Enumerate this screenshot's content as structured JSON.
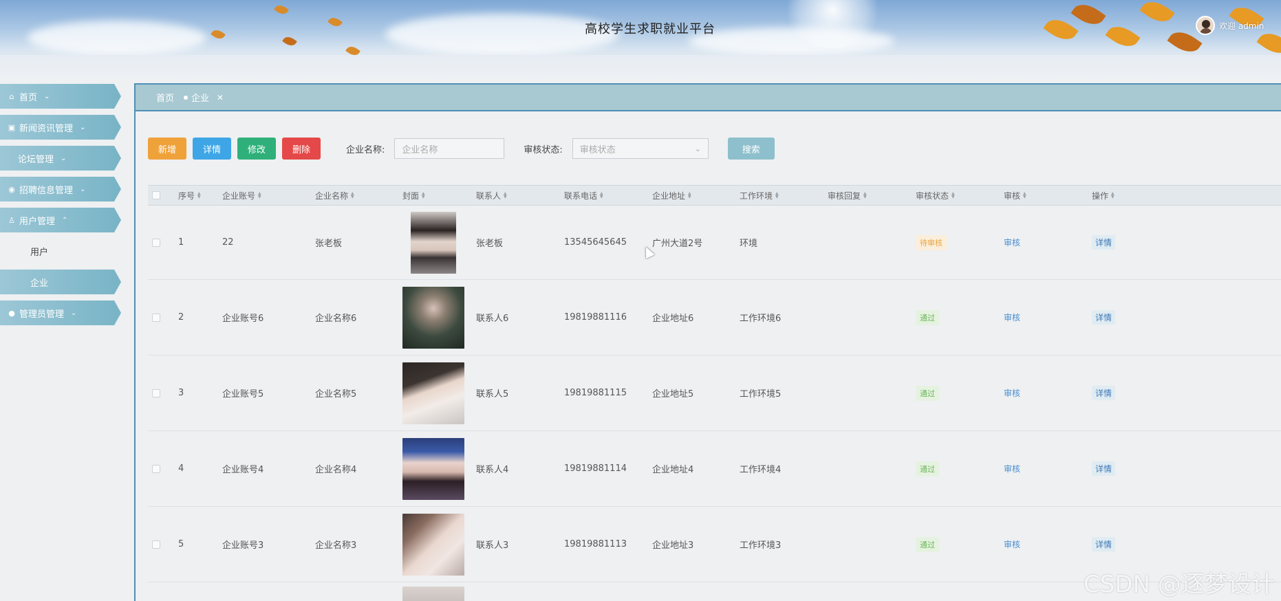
{
  "header": {
    "title": "高校学生求职就业平台",
    "user_text": "欢迎 admin"
  },
  "sidebar": {
    "items": [
      {
        "label": "首页",
        "icon": "home-icon"
      },
      {
        "label": "新闻资讯管理",
        "icon": "news-icon"
      },
      {
        "label": "论坛管理",
        "icon": ""
      },
      {
        "label": "招聘信息管理",
        "icon": "check-circle-icon"
      },
      {
        "label": "用户管理",
        "icon": "user-icon"
      },
      {
        "label": "管理员管理",
        "icon": "admin-icon"
      }
    ],
    "sub_items": [
      {
        "label": "用户"
      },
      {
        "label": "企业"
      }
    ]
  },
  "tabs": [
    {
      "label": "首页"
    },
    {
      "label": "企业"
    }
  ],
  "toolbar": {
    "add_label": "新增",
    "detail_label": "详情",
    "edit_label": "修改",
    "delete_label": "删除",
    "name_label": "企业名称:",
    "name_placeholder": "企业名称",
    "status_label": "审核状态:",
    "status_placeholder": "审核状态",
    "search_label": "搜索"
  },
  "table": {
    "columns": [
      "序号",
      "企业账号",
      "企业名称",
      "封面",
      "联系人",
      "联系电话",
      "企业地址",
      "工作环境",
      "审核回复",
      "审核状态",
      "审核",
      "操作"
    ],
    "rows": [
      {
        "no": "1",
        "account": "22",
        "name": "张老板",
        "contact": "张老板",
        "phone": "13545645645",
        "address": "广州大道2号",
        "env": "环境",
        "reply": "",
        "status": "待审核",
        "status_type": "wait",
        "audit": "审核",
        "op": "详情"
      },
      {
        "no": "2",
        "account": "企业账号6",
        "name": "企业名称6",
        "contact": "联系人6",
        "phone": "19819881116",
        "address": "企业地址6",
        "env": "工作环境6",
        "reply": "",
        "status": "通过",
        "status_type": "pass",
        "audit": "审核",
        "op": "详情"
      },
      {
        "no": "3",
        "account": "企业账号5",
        "name": "企业名称5",
        "contact": "联系人5",
        "phone": "19819881115",
        "address": "企业地址5",
        "env": "工作环境5",
        "reply": "",
        "status": "通过",
        "status_type": "pass",
        "audit": "审核",
        "op": "详情"
      },
      {
        "no": "4",
        "account": "企业账号4",
        "name": "企业名称4",
        "contact": "联系人4",
        "phone": "19819881114",
        "address": "企业地址4",
        "env": "工作环境4",
        "reply": "",
        "status": "通过",
        "status_type": "pass",
        "audit": "审核",
        "op": "详情"
      },
      {
        "no": "5",
        "account": "企业账号3",
        "name": "企业名称3",
        "contact": "联系人3",
        "phone": "19819881113",
        "address": "企业地址3",
        "env": "工作环境3",
        "reply": "",
        "status": "通过",
        "status_type": "pass",
        "audit": "审核",
        "op": "详情"
      }
    ]
  },
  "watermark": "CSDN @逐梦设计",
  "colors": {
    "accent": "#78b4c6",
    "border": "#4f8fb6",
    "add": "#f0a23a",
    "detail": "#3ea6e6",
    "edit": "#2fb07a",
    "delete": "#e54848",
    "search": "#8ebfcc"
  }
}
